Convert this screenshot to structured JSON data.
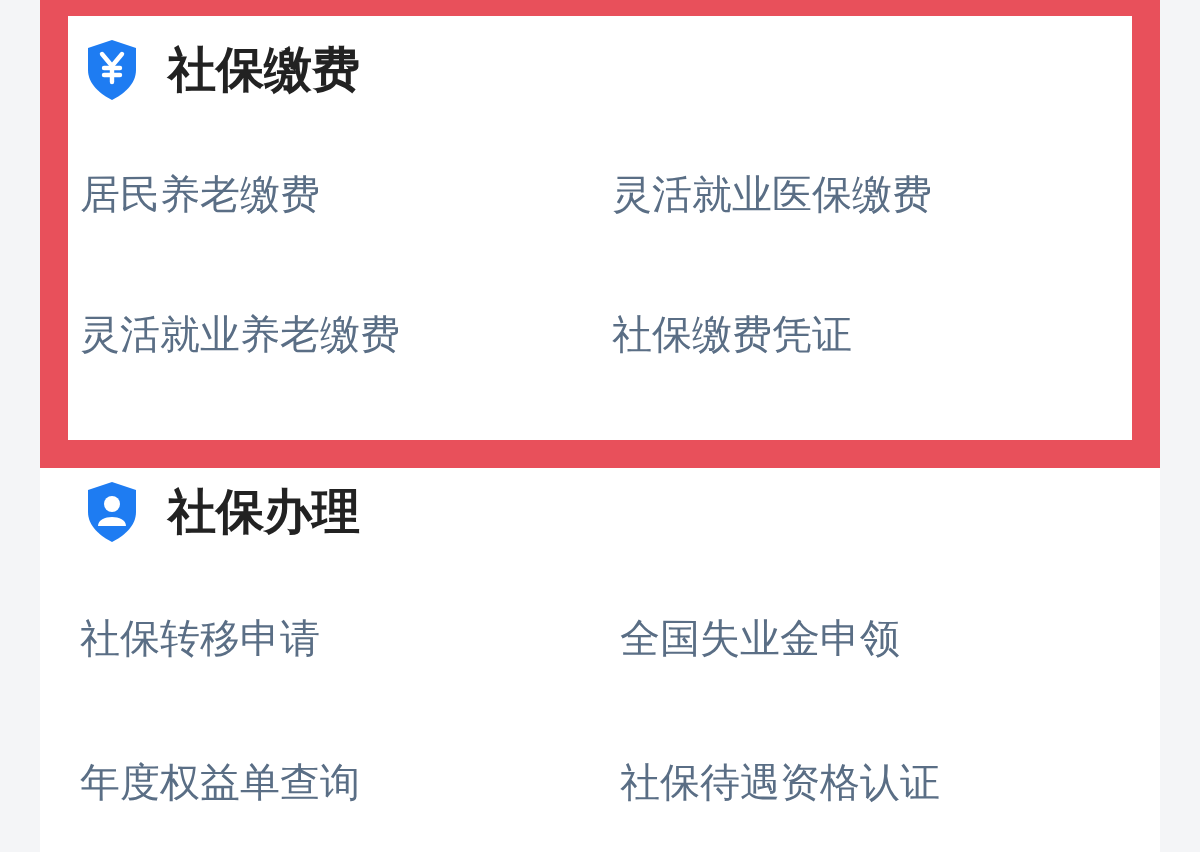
{
  "sections": [
    {
      "kind": "payment",
      "highlighted": true,
      "title": "社保缴费",
      "items": [
        "居民养老缴费",
        "灵活就业医保缴费",
        "灵活就业养老缴费",
        "社保缴费凭证"
      ]
    },
    {
      "kind": "person",
      "highlighted": false,
      "title": "社保办理",
      "items": [
        "社保转移申请",
        "全国失业金申领",
        "年度权益单查询",
        "社保待遇资格认证"
      ]
    }
  ]
}
